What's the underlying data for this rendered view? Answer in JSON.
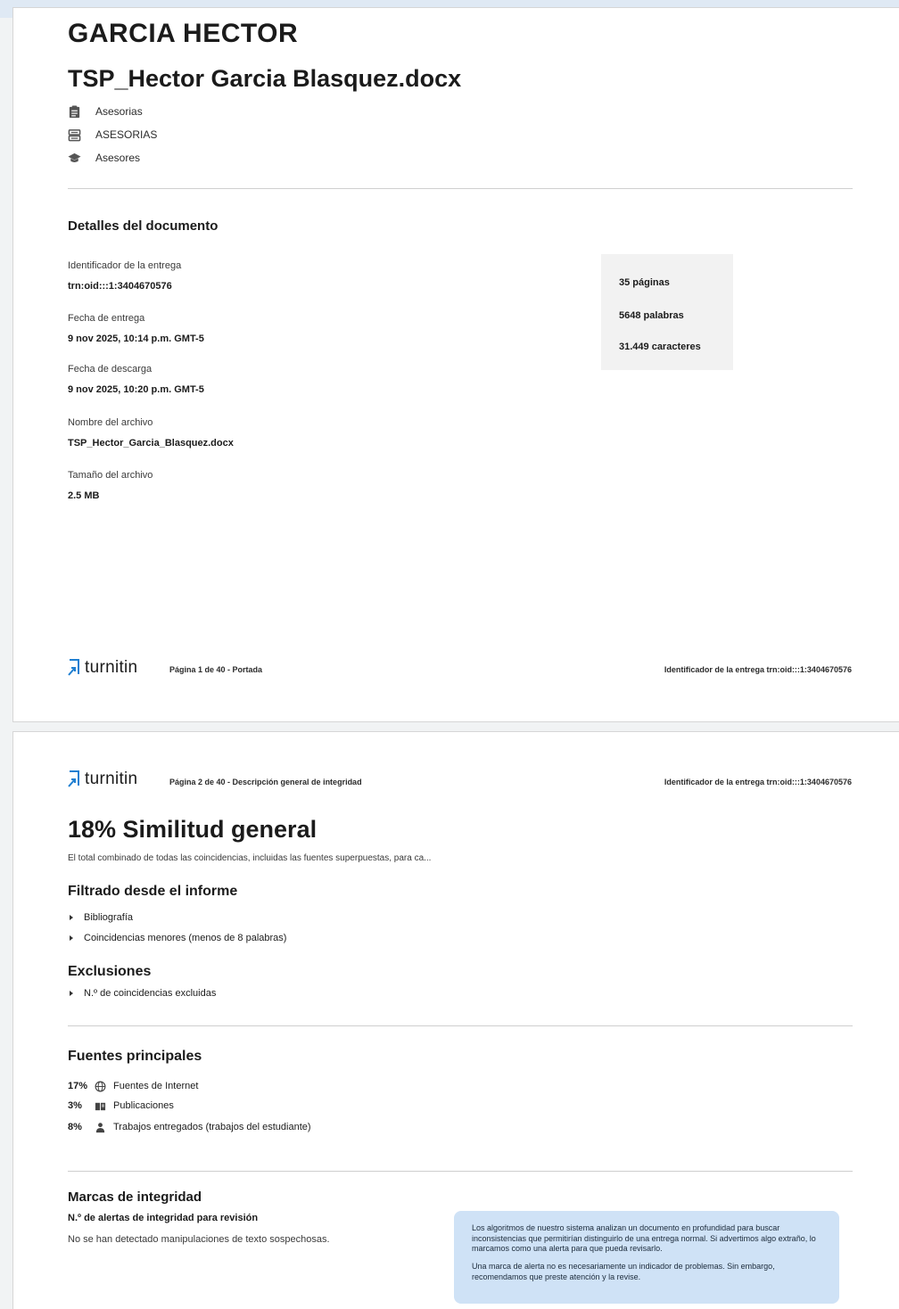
{
  "page1": {
    "author": "GARCIA HECTOR",
    "doc_title": "TSP_Hector Garcia Blasquez.docx",
    "meta": [
      {
        "icon": "clipboard-icon",
        "text": "Asesorias"
      },
      {
        "icon": "database-icon",
        "text": "ASESORIAS"
      },
      {
        "icon": "graduation-cap-icon",
        "text": "Asesores"
      }
    ],
    "details_heading": "Detalles del documento",
    "details": [
      {
        "label": "Identificador de la entrega",
        "value": "trn:oid:::1:3404670576"
      },
      {
        "label": "Fecha de entrega",
        "value": "9 nov 2025, 10:14 p.m. GMT-5"
      },
      {
        "label": "Fecha de descarga",
        "value": "9 nov 2025, 10:20 p.m. GMT-5"
      },
      {
        "label": "Nombre del archivo",
        "value": "TSP_Hector_Garcia_Blasquez.docx"
      },
      {
        "label": "Tamaño del archivo",
        "value": "2.5 MB"
      }
    ],
    "stats": [
      "35 páginas",
      "5648 palabras",
      "31.449 caracteres"
    ],
    "footer": {
      "logo": "turnitin",
      "page_info": "Página 1 de 40 - Portada",
      "submission_id": "Identificador de la entrega   trn:oid:::1:3404670576"
    }
  },
  "page2": {
    "header": {
      "logo": "turnitin",
      "page_info": "Página 2 de 40 - Descripción general de integridad",
      "submission_id": "Identificador de la entrega   trn:oid:::1:3404670576"
    },
    "similarity_title": "18% Similitud general",
    "similarity_desc": "El total combinado de todas las coincidencias, incluidas las fuentes superpuestas, para ca...",
    "filtered_heading": "Filtrado desde el informe",
    "filtered": [
      "Bibliografía",
      "Coincidencias menores (menos de 8 palabras)"
    ],
    "exclusions_heading": "Exclusiones",
    "exclusions": [
      "N.º de coincidencias excluidas"
    ],
    "sources_heading": "Fuentes principales",
    "sources": [
      {
        "pct": "17%",
        "icon": "globe-icon",
        "label": "Fuentes de Internet"
      },
      {
        "pct": "3%",
        "icon": "book-icon",
        "label": "Publicaciones"
      },
      {
        "pct": "8%",
        "icon": "person-icon",
        "label": "Trabajos entregados (trabajos del estudiante)"
      }
    ],
    "integrity_heading": "Marcas de integridad",
    "integrity_sub": "N.º de alertas de integridad para revisión",
    "integrity_text": "No se han detectado manipulaciones de texto sospechosas.",
    "info_p1": "Los algoritmos de nuestro sistema analizan un documento en profundidad para buscar inconsistencias que permitirían distinguirlo de una entrega normal. Si advertimos algo extraño, lo marcamos como una alerta para que pueda revisarlo.",
    "info_p2": "Una marca de alerta no es necesariamente un indicador de problemas. Sin embargo, recomendamos que preste atención y la revise."
  },
  "colors": {
    "logo_blue": "#1f7fd1",
    "info_box": "#cfe2f6",
    "top_bar": "#dfe9f4"
  }
}
